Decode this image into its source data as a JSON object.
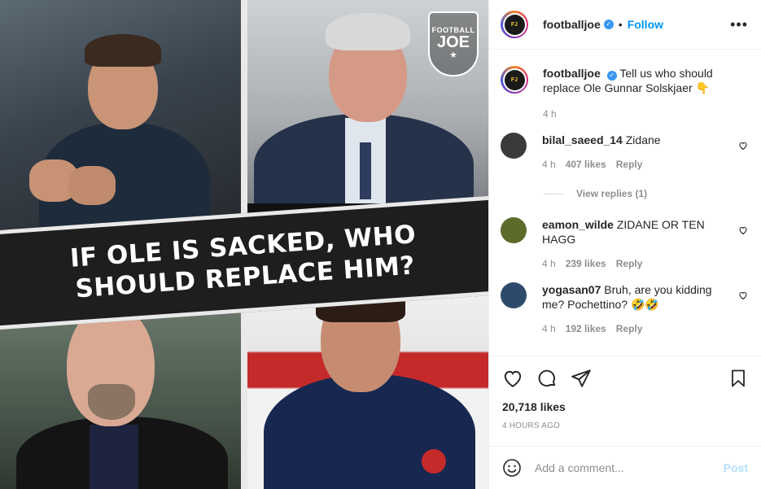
{
  "post": {
    "image": {
      "banner_line1": "IF OLE IS SACKED, WHO",
      "banner_line2": "SHOULD REPLACE HIM?",
      "logo": {
        "line1": "FOOTBALL",
        "line2": "JOE",
        "line3": "★"
      }
    },
    "header": {
      "username": "footballjoe",
      "follow_label": "Follow",
      "separator": "•",
      "more_label": "•••"
    },
    "caption": {
      "username": "footballjoe",
      "text": "Tell us who should replace Ole Gunnar Solskjaer 👇",
      "time": "4 h"
    },
    "comments": [
      {
        "username": "bilal_saeed_14",
        "text": "Zidane",
        "time": "4 h",
        "likes": "407 likes",
        "reply": "Reply",
        "avatar_color": "#3a3a3a"
      },
      {
        "username": "eamon_wilde",
        "text": "ZIDANE OR TEN HAGG",
        "time": "4 h",
        "likes": "239 likes",
        "reply": "Reply",
        "avatar_color": "#5d6b2a"
      },
      {
        "username": "yogasan07",
        "text": "Bruh, are you kidding me? Pochettino? 🤣🤣",
        "time": "4 h",
        "likes": "192 likes",
        "reply": "Reply",
        "avatar_color": "#2d4a6b"
      }
    ],
    "view_replies": "View replies (1)",
    "likes_count": "20,718 likes",
    "posted_ago": "4 HOURS AGO",
    "add_comment": {
      "placeholder": "Add a comment...",
      "post_label": "Post"
    }
  },
  "colors": {
    "accent": "#0095f6",
    "verified": "#3897f0",
    "post_disabled": "#b2dffc"
  }
}
